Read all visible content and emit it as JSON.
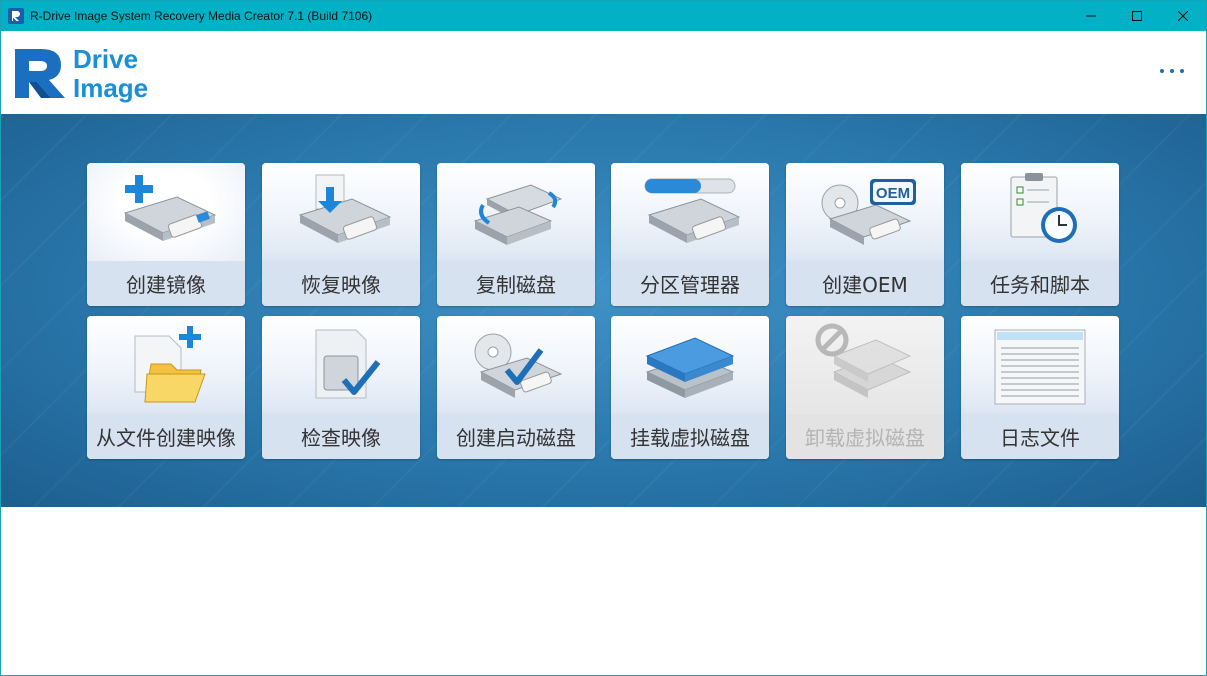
{
  "window": {
    "title": "R-Drive Image System Recovery Media Creator 7.1 (Build 7106)",
    "controls": [
      "minimize-icon",
      "maximize-icon",
      "close-icon"
    ]
  },
  "header": {
    "logo_line1": "Drive",
    "logo_line2": "Image",
    "more_icon": "ellipsis-icon"
  },
  "colors": {
    "titlebar": "#02b1c6",
    "panel": "#2a78ac",
    "brand": "#1b8fd6",
    "tile": "#d7e2f1"
  },
  "tiles": [
    {
      "label": "创建镜像",
      "icon": "create-image-icon",
      "enabled": true
    },
    {
      "label": "恢复映像",
      "icon": "restore-image-icon",
      "enabled": true
    },
    {
      "label": "复制磁盘",
      "icon": "copy-disk-icon",
      "enabled": true
    },
    {
      "label": "分区管理器",
      "icon": "partition-manager-icon",
      "enabled": true
    },
    {
      "label": "创建OEM",
      "icon": "create-oem-icon",
      "enabled": true
    },
    {
      "label": "任务和脚本",
      "icon": "tasks-scripts-icon",
      "enabled": true
    },
    {
      "label": "从文件创建映像",
      "icon": "image-from-files-icon",
      "enabled": true
    },
    {
      "label": "检查映像",
      "icon": "check-image-icon",
      "enabled": true
    },
    {
      "label": "创建启动磁盘",
      "icon": "create-boot-disk-icon",
      "enabled": true
    },
    {
      "label": "挂载虚拟磁盘",
      "icon": "mount-virtual-disk-icon",
      "enabled": true
    },
    {
      "label": "卸载虚拟磁盘",
      "icon": "unmount-virtual-disk-icon",
      "enabled": false
    },
    {
      "label": "日志文件",
      "icon": "log-file-icon",
      "enabled": true
    }
  ]
}
